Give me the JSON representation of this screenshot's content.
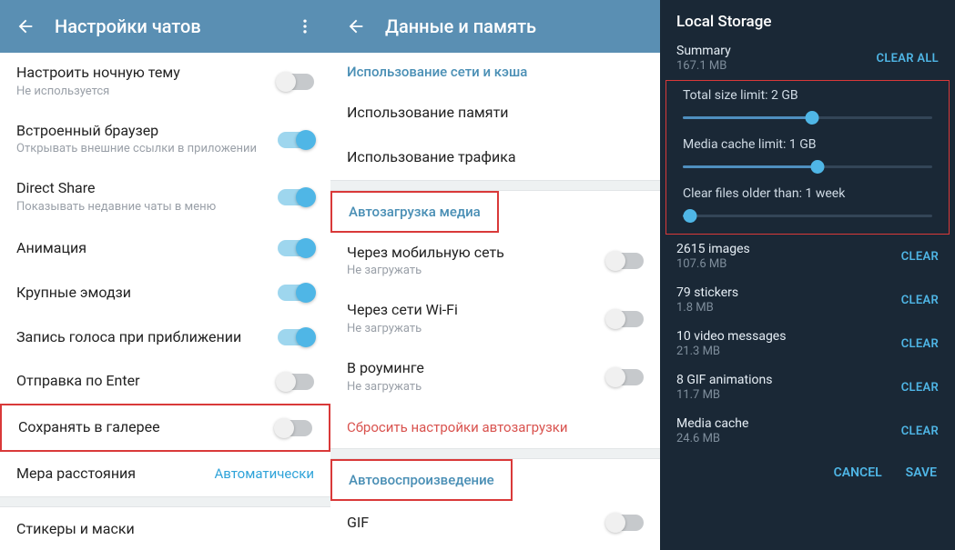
{
  "panel1": {
    "header": {
      "title": "Настройки чатов"
    },
    "items": [
      {
        "label": "Настроить ночную тему",
        "sub": "Не используется",
        "toggle": "off"
      },
      {
        "label": "Встроенный браузер",
        "sub": "Открывать внешние ссылки в приложении",
        "toggle": "on"
      },
      {
        "label": "Direct Share",
        "sub": "Показывать недавние чаты в меню",
        "toggle": "on"
      },
      {
        "label": "Анимация",
        "toggle": "on"
      },
      {
        "label": "Крупные эмодзи",
        "toggle": "on"
      },
      {
        "label": "Запись голоса при приближении",
        "toggle": "on"
      },
      {
        "label": "Отправка по Enter",
        "toggle": "off"
      },
      {
        "label": "Сохранять в галерее",
        "toggle": "off",
        "highlight": true
      },
      {
        "label": "Мера расстояния",
        "value": "Автоматически"
      },
      {
        "label": "Стикеры и маски"
      }
    ]
  },
  "panel2": {
    "header": {
      "title": "Данные и память"
    },
    "section_usage": {
      "title": "Использование сети и кэша",
      "items": [
        {
          "label": "Использование памяти"
        },
        {
          "label": "Использование трафика"
        }
      ]
    },
    "section_autoload": {
      "title": "Автозагрузка медиа",
      "items": [
        {
          "label": "Через мобильную сеть",
          "sub": "Не загружать",
          "toggle": "off"
        },
        {
          "label": "Через сети Wi-Fi",
          "sub": "Не загружать",
          "toggle": "off"
        },
        {
          "label": "В роуминге",
          "sub": "Не загружать",
          "toggle": "off"
        }
      ],
      "reset": "Сбросить настройки автозагрузки"
    },
    "section_autoplay": {
      "title": "Автовоспроизведение",
      "items": [
        {
          "label": "GIF",
          "toggle": "off"
        }
      ]
    }
  },
  "panel3": {
    "title": "Local Storage",
    "summary": {
      "label": "Summary",
      "value": "167.1 MB",
      "action": "CLEAR ALL"
    },
    "sliders": [
      {
        "label": "Total size limit: 2 GB",
        "pct": 52
      },
      {
        "label": "Media cache limit: 1 GB",
        "pct": 54
      },
      {
        "label": "Clear files older than: 1 week",
        "pct": 3
      }
    ],
    "items": [
      {
        "title": "2615 images",
        "sub": "107.6 MB",
        "action": "CLEAR"
      },
      {
        "title": "79 stickers",
        "sub": "1.8 MB",
        "action": "CLEAR"
      },
      {
        "title": "10 video messages",
        "sub": "21.3 MB",
        "action": "CLEAR"
      },
      {
        "title": "8 GIF animations",
        "sub": "11.7 MB",
        "action": "CLEAR"
      },
      {
        "title": "Media cache",
        "sub": "24.6 MB",
        "action": "CLEAR"
      }
    ],
    "footer": {
      "cancel": "CANCEL",
      "save": "SAVE"
    }
  }
}
